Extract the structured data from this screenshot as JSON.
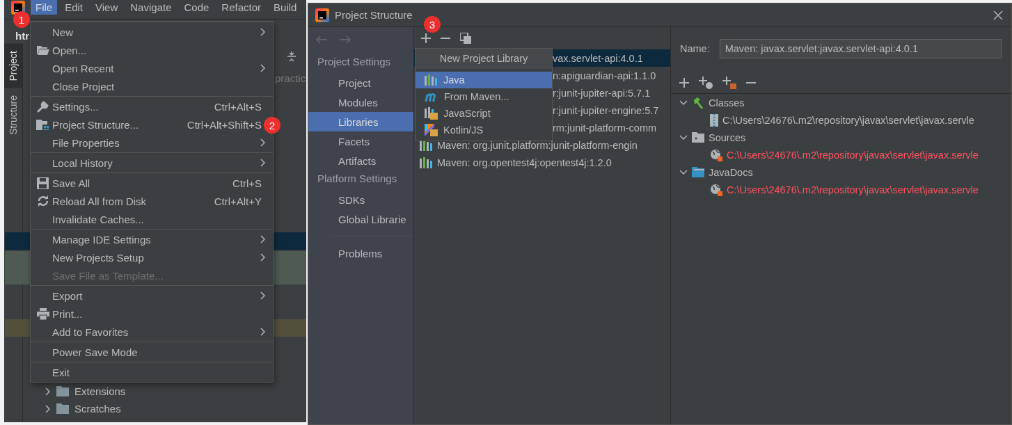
{
  "ide": {
    "menu_bar": [
      {
        "label": "File",
        "selected": true
      },
      {
        "label": "Edit",
        "selected": false
      },
      {
        "label": "View",
        "selected": false
      },
      {
        "label": "Navigate",
        "selected": false
      },
      {
        "label": "Code",
        "selected": false
      },
      {
        "label": "Refactor",
        "selected": false
      },
      {
        "label": "Build",
        "selected": false
      }
    ],
    "editor_tab": "htr",
    "tool_tabs": [
      {
        "label": "Project",
        "selected": true
      },
      {
        "label": "Structure",
        "selected": false
      }
    ],
    "path_hint": "practic",
    "tree": [
      {
        "label": "Extensions",
        "expanded": false
      },
      {
        "label": "Scratches",
        "expanded": false
      }
    ]
  },
  "file_menu": {
    "groups": [
      [
        {
          "label": "New",
          "submenu": true,
          "disabled": false
        },
        {
          "label": "Open...",
          "submenu": false,
          "disabled": false
        },
        {
          "label": "Open Recent",
          "submenu": true,
          "disabled": false
        },
        {
          "label": "Close Project",
          "submenu": false,
          "disabled": false
        }
      ],
      [
        {
          "label": "Settings...",
          "shortcut": "Ctrl+Alt+S",
          "submenu": false,
          "disabled": false
        },
        {
          "label": "Project Structure...",
          "shortcut": "Ctrl+Alt+Shift+S",
          "submenu": false,
          "disabled": false
        },
        {
          "label": "File Properties",
          "submenu": true,
          "disabled": false
        }
      ],
      [
        {
          "label": "Local History",
          "submenu": true,
          "disabled": false
        }
      ],
      [
        {
          "label": "Save All",
          "shortcut": "Ctrl+S",
          "submenu": false,
          "disabled": false
        },
        {
          "label": "Reload All from Disk",
          "shortcut": "Ctrl+Alt+Y",
          "submenu": false,
          "disabled": false
        },
        {
          "label": "Invalidate Caches...",
          "submenu": false,
          "disabled": false
        }
      ],
      [
        {
          "label": "Manage IDE Settings",
          "submenu": true,
          "disabled": false
        },
        {
          "label": "New Projects Setup",
          "submenu": true,
          "disabled": false
        },
        {
          "label": "Save File as Template...",
          "submenu": false,
          "disabled": true
        }
      ],
      [
        {
          "label": "Export",
          "submenu": true,
          "disabled": false
        },
        {
          "label": "Print...",
          "submenu": false,
          "disabled": false
        },
        {
          "label": "Add to Favorites",
          "submenu": true,
          "disabled": false
        }
      ],
      [
        {
          "label": "Power Save Mode",
          "submenu": false,
          "disabled": false
        }
      ],
      [
        {
          "label": "Exit",
          "submenu": false,
          "disabled": false
        }
      ]
    ]
  },
  "dialog": {
    "title": "Project Structure",
    "nav": {
      "sections": [
        {
          "header": "Project Settings",
          "items": [
            {
              "label": "Project",
              "selected": false
            },
            {
              "label": "Modules",
              "selected": false
            },
            {
              "label": "Libraries",
              "selected": true
            },
            {
              "label": "Facets",
              "selected": false
            },
            {
              "label": "Artifacts",
              "selected": false
            }
          ]
        },
        {
          "header": "Platform Settings",
          "items": [
            {
              "label": "SDKs",
              "selected": false
            },
            {
              "label": "Global Librarie",
              "selected": false
            }
          ]
        }
      ],
      "extra_items": [
        {
          "label": "Problems",
          "selected": false
        }
      ]
    },
    "libraries": [
      {
        "kind": "partial",
        "label": "vax.servlet-api:4.0.1",
        "selected": true
      },
      {
        "kind": "partial",
        "label": "n:apiguardian-api:1.1.0",
        "selected": false
      },
      {
        "kind": "partial",
        "label": "r:junit-jupiter-api:5.7.1",
        "selected": false
      },
      {
        "kind": "partial",
        "label": "r:junit-jupiter-engine:5.7",
        "selected": false
      },
      {
        "kind": "partial",
        "label": "rm:junit-platform-comm",
        "selected": false
      },
      {
        "kind": "full",
        "label": "Maven: org.junit.platform:junit-platform-engin",
        "selected": false
      },
      {
        "kind": "full",
        "label": "Maven: org.opentest4j:opentest4j:1.2.0",
        "selected": false
      }
    ],
    "popup": {
      "title": "New Project Library",
      "items": [
        {
          "label": "Java",
          "selected": true
        },
        {
          "label": "From Maven...",
          "selected": false
        },
        {
          "label": "JavaScript",
          "selected": false
        },
        {
          "label": "Kotlin/JS",
          "selected": false
        }
      ]
    },
    "name_label": "Name:",
    "name_value": "Maven: javax.servlet:javax.servlet-api:4.0.1",
    "roots": [
      {
        "label": "Classes",
        "expanded": true,
        "children": [
          {
            "path": "C:\\Users\\24676\\.m2\\repository\\javax\\servlet\\javax.servle",
            "invalid": false
          }
        ]
      },
      {
        "label": "Sources",
        "expanded": true,
        "children": [
          {
            "path": "C:\\Users\\24676\\.m2\\repository\\javax\\servlet\\javax.servle",
            "invalid": true
          }
        ]
      },
      {
        "label": "JavaDocs",
        "expanded": true,
        "children": [
          {
            "path": "C:\\Users\\24676\\.m2\\repository\\javax\\servlet\\javax.servle",
            "invalid": true
          }
        ]
      }
    ]
  },
  "annotations": [
    "1",
    "2",
    "3"
  ]
}
